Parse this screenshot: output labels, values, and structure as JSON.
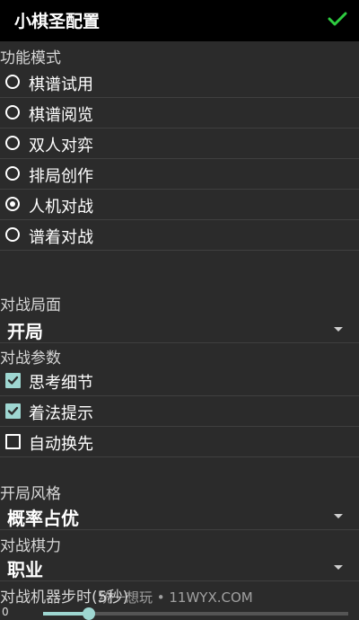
{
  "header": {
    "title": "小棋圣配置",
    "confirm_icon": "check-icon",
    "accent": "#2ecc40"
  },
  "function_mode": {
    "label": "功能模式",
    "options": [
      {
        "label": "棋谱试用",
        "selected": false
      },
      {
        "label": "棋谱阅览",
        "selected": false
      },
      {
        "label": "双人对弈",
        "selected": false
      },
      {
        "label": "排局创作",
        "selected": false
      },
      {
        "label": "人机对战",
        "selected": true
      },
      {
        "label": "谱着对战",
        "selected": false
      }
    ]
  },
  "board_position": {
    "label": "对战局面",
    "value": "开局"
  },
  "battle_params": {
    "label": "对战参数",
    "options": [
      {
        "label": "思考细节",
        "checked": true
      },
      {
        "label": "着法提示",
        "checked": true
      },
      {
        "label": "自动换先",
        "checked": false
      }
    ]
  },
  "opening_style": {
    "label": "开局风格",
    "value": "概率占优"
  },
  "battle_strength": {
    "label": "对战棋力",
    "value": "职业"
  },
  "machine_step_time": {
    "label": "对战机器步时(5秒)",
    "min_label": "0",
    "value_fraction": 0.15
  },
  "watermark": "统一想玩 • 11WYX.COM",
  "colors": {
    "background": "#2b2b2b",
    "topbar": "#000000",
    "checkbox_accent": "#9ed6d1"
  }
}
